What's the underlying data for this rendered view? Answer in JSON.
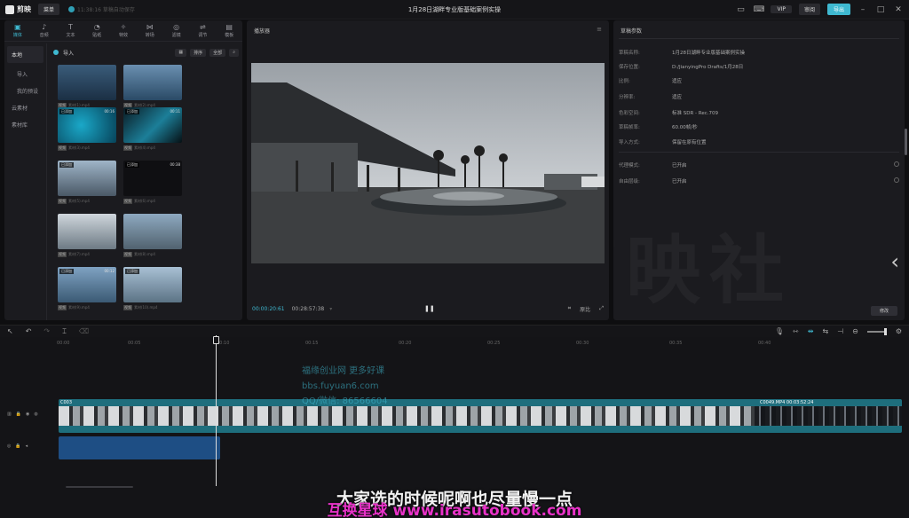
{
  "topbar": {
    "app_name": "剪映",
    "menu_label": "菜单",
    "save_status": "11:38:16 草稿自动保存",
    "project_title": "1月28日湖畔专业版基础案例实操",
    "vip_label": "VIP",
    "publish_label": "审阅",
    "export_label": "导出"
  },
  "media_tabs": [
    {
      "icon": "media-icon",
      "label": "媒体"
    },
    {
      "icon": "audio-icon",
      "label": "音频"
    },
    {
      "icon": "text-icon",
      "label": "文本"
    },
    {
      "icon": "sticker-icon",
      "label": "贴纸"
    },
    {
      "icon": "effects-icon",
      "label": "特效"
    },
    {
      "icon": "transition-icon",
      "label": "转场"
    },
    {
      "icon": "filter-icon",
      "label": "滤镜"
    },
    {
      "icon": "adjust-icon",
      "label": "调节"
    },
    {
      "icon": "template-icon",
      "label": "模板"
    }
  ],
  "media_side": [
    {
      "label": "本地",
      "selected": true
    },
    {
      "label": "导入",
      "selected": false
    },
    {
      "label": "我的预设",
      "selected": false
    },
    {
      "label": "云素材",
      "selected": false
    },
    {
      "label": "素材库",
      "selected": false
    }
  ],
  "media_toolbar": {
    "import_label": "导入",
    "sort_label": "排序",
    "all_label": "全部"
  },
  "media_items": [
    {
      "added": "",
      "duration": "",
      "name": "素材(1).mp4"
    },
    {
      "added": "",
      "duration": "",
      "name": "素材(2).mp4"
    },
    {
      "added": "已添加",
      "duration": "00:16",
      "name": "素材(3).mp4"
    },
    {
      "added": "已添加",
      "duration": "00:11",
      "name": "素材(4).mp4"
    },
    {
      "added": "已添加",
      "duration": "",
      "name": "素材(5).mp4"
    },
    {
      "added": "已添加",
      "duration": "00:38",
      "name": "素材(6).mp4"
    },
    {
      "added": "",
      "duration": "",
      "name": "素材(7).mp4"
    },
    {
      "added": "",
      "duration": "",
      "name": "素材(8).mp4"
    },
    {
      "added": "已添加",
      "duration": "00:12",
      "name": "素材(9).mp4"
    },
    {
      "added": "已添加",
      "duration": "",
      "name": "素材(10).mp4"
    }
  ],
  "player": {
    "title": "播放器",
    "current_time": "00:00:20:61",
    "total_time": "00:28:57:38",
    "ratio_label": "适应",
    "original_label": "原比"
  },
  "props": {
    "title": "草稿参数",
    "rows": [
      {
        "key": "草稿名称:",
        "value": "1月28日湖畔专业版基础案例实操"
      },
      {
        "key": "保存位置:",
        "value": "D:/JianyingPro Drafts/1月28日"
      },
      {
        "key": "比例:",
        "value": "适应"
      },
      {
        "key": "分辨率:",
        "value": "适应"
      },
      {
        "key": "色彩空间:",
        "value": "标准 SDR - Rec.709"
      },
      {
        "key": "草稿帧率:",
        "value": "60.00帧/秒"
      },
      {
        "key": "导入方式:",
        "value": "保留在原有位置"
      },
      {
        "key": "代理模式:",
        "value": "已开启"
      },
      {
        "key": "自由层级:",
        "value": "已开启"
      }
    ],
    "modify_label": "修改",
    "bg_watermark": "剪映社"
  },
  "timeline": {
    "ruler": [
      "00:00",
      "00:05",
      "00:10",
      "00:15",
      "00:20",
      "00:25",
      "00:30",
      "00:35",
      "00:40"
    ],
    "clip1_label": "C003",
    "clip2_label": "C0049.MP4  00:03:52:24",
    "overlay_line1": "福缘创业网 更多好课",
    "overlay_line2": "bbs.fuyuan6.com",
    "overlay_line3": "QQ/微信: 86566604"
  },
  "subtitle": "大家选的时候呢啊也尽量慢一点",
  "brand_watermark": "互换星球 www.irasutobook.com",
  "colors": {
    "accent": "#3fb9d1",
    "video_track": "#1e6e7d",
    "audio_track": "#1e4e84"
  }
}
